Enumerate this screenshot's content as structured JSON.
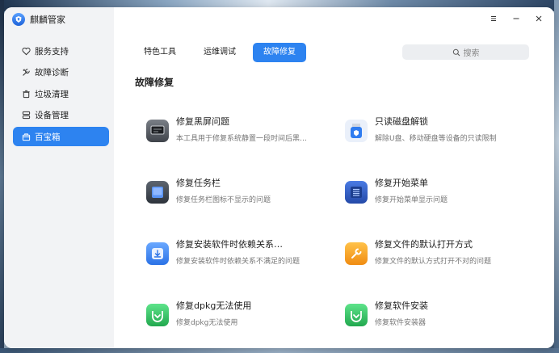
{
  "app": {
    "name": "麒麟管家"
  },
  "sidebar": {
    "items": [
      {
        "label": "服务支持",
        "icon": "heart-icon"
      },
      {
        "label": "故障诊断",
        "icon": "wrench-icon"
      },
      {
        "label": "垃圾清理",
        "icon": "trash-icon"
      },
      {
        "label": "设备管理",
        "icon": "device-icon"
      },
      {
        "label": "百宝箱",
        "icon": "toolbox-icon",
        "active": true
      }
    ]
  },
  "tabs": [
    {
      "label": "特色工具"
    },
    {
      "label": "运维调试"
    },
    {
      "label": "故障修复",
      "active": true
    }
  ],
  "search": {
    "placeholder": "搜索"
  },
  "section": {
    "title": "故障修复"
  },
  "tools": [
    {
      "title": "修复黑屏问题",
      "desc": "本工具用于修复系统静置一段时间后黑…",
      "icon": "black-screen-icon",
      "color": "#5b5f66"
    },
    {
      "title": "只读磁盘解锁",
      "desc": "解除U盘、移动硬盘等设备的只读限制",
      "icon": "disk-unlock-icon",
      "color": "#e8eef8"
    },
    {
      "title": "修复任务栏",
      "desc": "修复任务栏图标不显示的问题",
      "icon": "taskbar-icon",
      "color": "#3f6fd6"
    },
    {
      "title": "修复开始菜单",
      "desc": "修复开始菜单显示问题",
      "icon": "start-menu-icon",
      "color": "#3a64c9"
    },
    {
      "title": "修复安装软件时依赖关系…",
      "desc": "修复安装软件时依赖关系不满足的问题",
      "icon": "dependency-icon",
      "color": "#4a8ff0"
    },
    {
      "title": "修复文件的默认打开方式",
      "desc": "修复文件的默认方式打开不对的问题",
      "icon": "open-with-icon",
      "color": "#f5a623"
    },
    {
      "title": "修复dpkg无法使用",
      "desc": "修复dpkg无法使用",
      "icon": "dpkg-icon",
      "color": "#3cc466"
    },
    {
      "title": "修复软件安装",
      "desc": "修复软件安装器",
      "icon": "software-install-icon",
      "color": "#3cc466"
    }
  ]
}
